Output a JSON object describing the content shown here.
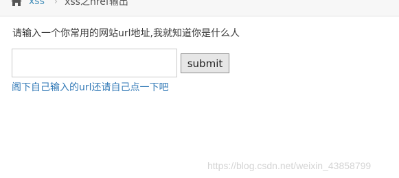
{
  "breadcrumb": {
    "home_icon": "home-icon",
    "link_label": "xss",
    "separator_icon": "chevron-right-icon",
    "current_label": "xss之href输出"
  },
  "form": {
    "prompt": "请输入一个你常用的网站url地址,我就知道你是什么人",
    "url_value": "",
    "submit_label": "submit",
    "hint": "阁下自己输入的url还请自己点一下吧"
  },
  "watermark": "https://blog.csdn.net/weixin_43858799",
  "colors": {
    "link": "#438eb9",
    "hint": "#337ab7"
  }
}
